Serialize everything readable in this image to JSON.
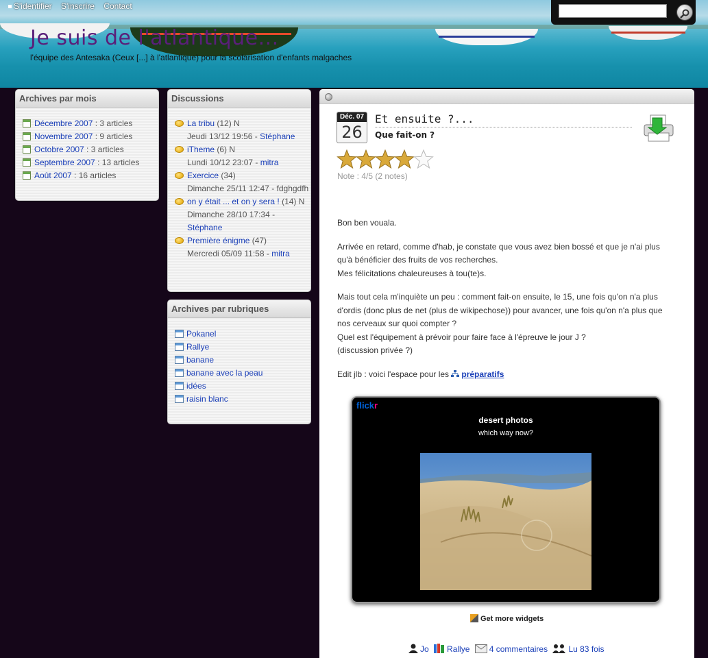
{
  "topnav": {
    "login": "S'identifier",
    "register": "S'inscrire",
    "contact": "Contact"
  },
  "site": {
    "title": "Je suis de l'atlantique...",
    "tagline": "l'équipe des Antesaka (Ceux [...] à l'atlantique) pour la scolarisation d'enfants malgaches"
  },
  "search": {
    "value": "",
    "placeholder": ""
  },
  "archives_mois": {
    "title": "Archives par mois",
    "items": [
      {
        "label": "Décembre 2007",
        "count": " : 3 articles"
      },
      {
        "label": "Novembre 2007",
        "count": " : 9 articles"
      },
      {
        "label": "Octobre 2007",
        "count": " : 3 articles"
      },
      {
        "label": "Septembre 2007",
        "count": " : 13 articles"
      },
      {
        "label": "Août 2007",
        "count": " : 16 articles"
      }
    ]
  },
  "discussions": {
    "title": "Discussions",
    "items": [
      {
        "topic": "La tribu",
        "count": " (12) N",
        "date": "Jeudi 13/12 19:56 - ",
        "author": "Stéphane"
      },
      {
        "topic": "iTheme",
        "count": " (6) N",
        "date": "Lundi 10/12 23:07 - ",
        "author": "mitra"
      },
      {
        "topic": "Exercice",
        "count": " (34)",
        "date": "Dimanche 25/11 12:47 - fdghgdfh",
        "author": ""
      },
      {
        "topic": "on y était ... et on y sera !",
        "count": " (14) N",
        "date": "Dimanche 28/10 17:34 - ",
        "author": "Stéphane"
      },
      {
        "topic": "Première énigme",
        "count": " (47)",
        "date": "Mercredi 05/09 11:58 - ",
        "author": "mitra"
      }
    ]
  },
  "archives_rubriques": {
    "title": "Archives par rubriques",
    "items": [
      "Pokanel",
      "Rallye",
      "banane",
      "banane avec la peau",
      "idées",
      "raisin blanc"
    ]
  },
  "article": {
    "month": "Déc. 07",
    "day": "26",
    "title": "Et ensuite ?...",
    "subtitle": "Que fait-on ?",
    "rating": 4,
    "rating_max": 5,
    "rating_note": "Note : 4/5 (2 notes)",
    "p1": "Bon ben vouala.",
    "p2a": "Arrivée en retard, comme d'hab, je constate que vous avez bien bossé et que je n'ai plus qu'à bénéficier des fruits de vos recherches.",
    "p2b": "Mes félicitations chaleureuses à tou(te)s.",
    "p3a": "Mais tout cela m'inquiète un peu : comment fait-on ensuite, le 15, une fois qu'on n'a plus d'ordis (donc plus de net (plus de wikipechose)) pour avancer, une fois qu'on n'a plus que nos cerveaux sur quoi compter ?",
    "p3b": "Quel est l'équipement à prévoir pour faire face à l'épreuve le jour J ?",
    "p3c": "(discussion privée ?)",
    "p4_prefix": "Edit jlb : voici l'espace pour les ",
    "p4_link": "préparatifs",
    "author": "Jo",
    "category": "Rallye",
    "comments": "4 commentaires",
    "reads": "Lu 83 fois"
  },
  "flickr": {
    "logo_a": "flick",
    "logo_b": "r",
    "heading": "desert photos",
    "subheading": "which way now?",
    "more": "Get more widgets"
  },
  "colors": {
    "background": "#150619",
    "title": "#5a1f7a",
    "link": "#1a3fb8"
  }
}
